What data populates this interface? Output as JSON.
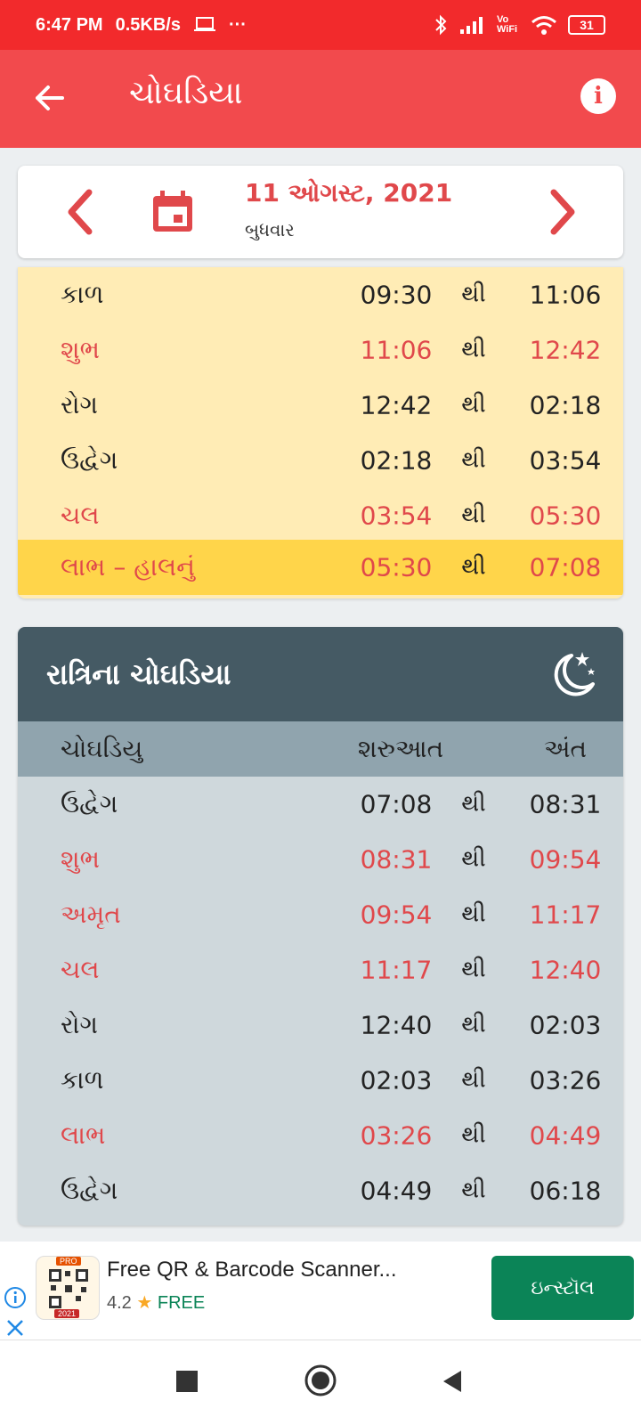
{
  "status": {
    "time": "6:47 PM",
    "speed": "0.5KB/s",
    "dots": "···",
    "vowifi": "Vo WiFi",
    "battery": "31"
  },
  "appbar": {
    "title": "ચોઘડિયા",
    "info_glyph": "i"
  },
  "date": {
    "text": "11 ઓગસ્ટ, 2021",
    "weekday": "બુધવાર"
  },
  "day_rows": [
    {
      "name": "કાળ",
      "start": "09:30",
      "sep": "થી",
      "end": "11:06",
      "highlight": false,
      "current": false
    },
    {
      "name": "શુભ",
      "start": "11:06",
      "sep": "થી",
      "end": "12:42",
      "highlight": true,
      "current": false
    },
    {
      "name": "રોગ",
      "start": "12:42",
      "sep": "થી",
      "end": "02:18",
      "highlight": false,
      "current": false
    },
    {
      "name": "ઉદ્વેગ",
      "start": "02:18",
      "sep": "થી",
      "end": "03:54",
      "highlight": false,
      "current": false
    },
    {
      "name": "ચલ",
      "start": "03:54",
      "sep": "થી",
      "end": "05:30",
      "highlight": true,
      "current": false
    },
    {
      "name": "લાભ – હાલનું",
      "start": "05:30",
      "sep": "થી",
      "end": "07:08",
      "highlight": true,
      "current": true
    }
  ],
  "night": {
    "title": "રાત્રિના ચોઘડિયા",
    "headers": {
      "name": "ચોઘડિયુ",
      "start": "શરુઆત",
      "end": "અંત"
    },
    "rows": [
      {
        "name": "ઉદ્વેગ",
        "start": "07:08",
        "sep": "થી",
        "end": "08:31",
        "highlight": false
      },
      {
        "name": "શુભ",
        "start": "08:31",
        "sep": "થી",
        "end": "09:54",
        "highlight": true
      },
      {
        "name": "અમૃત",
        "start": "09:54",
        "sep": "થી",
        "end": "11:17",
        "highlight": true
      },
      {
        "name": "ચલ",
        "start": "11:17",
        "sep": "થી",
        "end": "12:40",
        "highlight": true
      },
      {
        "name": "રોગ",
        "start": "12:40",
        "sep": "થી",
        "end": "02:03",
        "highlight": false
      },
      {
        "name": "કાળ",
        "start": "02:03",
        "sep": "થી",
        "end": "03:26",
        "highlight": false
      },
      {
        "name": "લાભ",
        "start": "03:26",
        "sep": "થી",
        "end": "04:49",
        "highlight": true
      },
      {
        "name": "ઉદ્વેગ",
        "start": "04:49",
        "sep": "થી",
        "end": "06:18",
        "highlight": false
      }
    ]
  },
  "ad": {
    "title": "Free QR & Barcode Scanner...",
    "rating": "4.2",
    "star": "★",
    "price": "FREE",
    "install": "ઇન્સ્ટૉલ",
    "icon_badge_top": "PRO",
    "icon_badge_bottom": "2021"
  },
  "colors": {
    "primary": "#f24a4d",
    "status": "#f22a2c",
    "highlight_text": "#e0484b",
    "day_bg": "#ffecb5",
    "current_bg": "#ffd54a",
    "night_head": "#455a64",
    "night_col": "#90a4ae",
    "night_bg": "#cfd8dc",
    "install": "#0b8457"
  },
  "icons": [
    "back-arrow-icon",
    "info-icon",
    "chevron-left-icon",
    "calendar-icon",
    "chevron-right-icon",
    "moon-stars-icon",
    "ad-info-icon",
    "ad-close-icon",
    "nav-recents-icon",
    "nav-home-icon",
    "nav-back-icon"
  ]
}
